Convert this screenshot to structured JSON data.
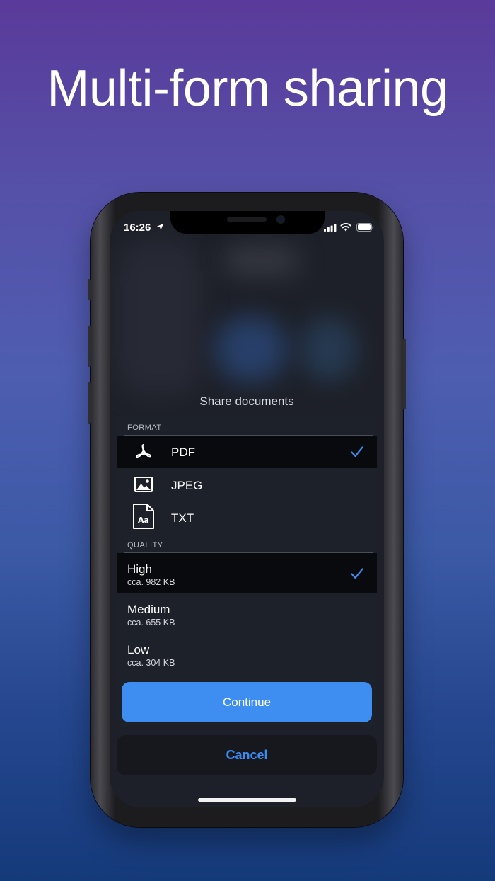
{
  "headline": "Multi-form sharing",
  "status_bar": {
    "time": "16:26",
    "icons": [
      "location-arrow-icon",
      "signal-icon",
      "wifi-icon",
      "battery-icon"
    ]
  },
  "share_sheet": {
    "title": "Share documents",
    "format_section": {
      "header": "FORMAT",
      "options": [
        {
          "label": "PDF",
          "icon": "pdf-icon",
          "selected": true
        },
        {
          "label": "JPEG",
          "icon": "image-icon",
          "selected": false
        },
        {
          "label": "TXT",
          "icon": "text-document-icon",
          "selected": false
        }
      ]
    },
    "quality_section": {
      "header": "QUALITY",
      "options": [
        {
          "label": "High",
          "size": "cca. 982 KB",
          "selected": true
        },
        {
          "label": "Medium",
          "size": "cca. 655 KB",
          "selected": false
        },
        {
          "label": "Low",
          "size": "cca. 304 KB",
          "selected": false
        }
      ]
    },
    "continue_label": "Continue",
    "cancel_label": "Cancel"
  },
  "colors": {
    "accent": "#3d8ef0",
    "cancel_text": "#3b8cf2",
    "background_top": "#5a3a9a",
    "background_bottom": "#153a7a"
  }
}
